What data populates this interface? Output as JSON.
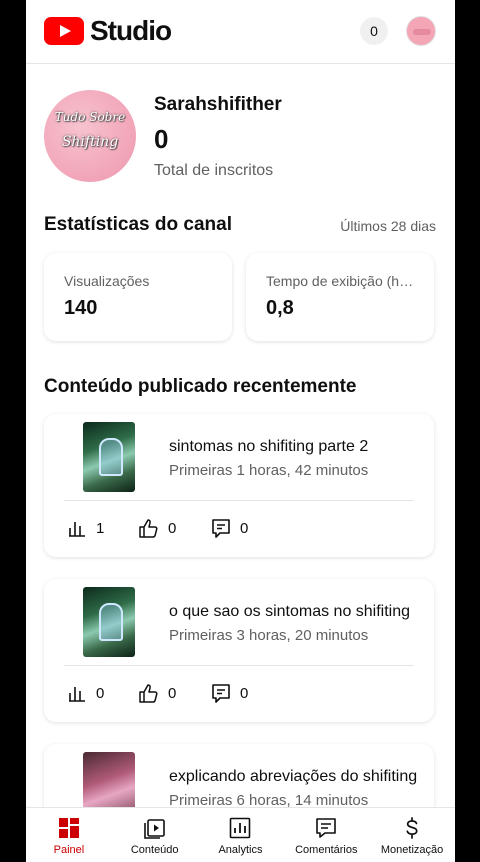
{
  "header": {
    "app_title": "Studio",
    "notification_count": "0"
  },
  "channel": {
    "avatar_text_line1": "Tudo Sobre",
    "avatar_text_line2": "Shifting",
    "name": "Sarahshifither",
    "subscribers": "0",
    "subscribers_label": "Total de inscritos"
  },
  "stats": {
    "title": "Estatísticas do canal",
    "range": "Últimos 28 dias",
    "cards": [
      {
        "label": "Visualizações",
        "value": "140"
      },
      {
        "label": "Tempo de exibição (horas)",
        "value": "0,8"
      }
    ]
  },
  "recent": {
    "title": "Conteúdo publicado recentemente",
    "videos": [
      {
        "title": "sintomas no shifiting parte 2",
        "subtitle": "Primeiras 1 horas, 42 minutos",
        "views": "1",
        "likes": "0",
        "comments": "0"
      },
      {
        "title": "o que sao os sintomas no shifiting",
        "subtitle": "Primeiras 3 horas, 20 minutos",
        "views": "0",
        "likes": "0",
        "comments": "0"
      },
      {
        "title": "explicando abreviações do shifiting",
        "subtitle": "Primeiras 6 horas, 14 minutos"
      }
    ]
  },
  "nav": {
    "items": [
      {
        "label": "Painel",
        "icon": "dashboard-icon",
        "active": true
      },
      {
        "label": "Conteúdo",
        "icon": "content-icon"
      },
      {
        "label": "Analytics",
        "icon": "analytics-icon"
      },
      {
        "label": "Comentários",
        "icon": "comments-icon"
      },
      {
        "label": "Monetização",
        "icon": "monetization-icon"
      }
    ]
  },
  "colors": {
    "accent": "#ff0000",
    "active_nav": "#cc0000",
    "secondary_text": "#606060"
  }
}
